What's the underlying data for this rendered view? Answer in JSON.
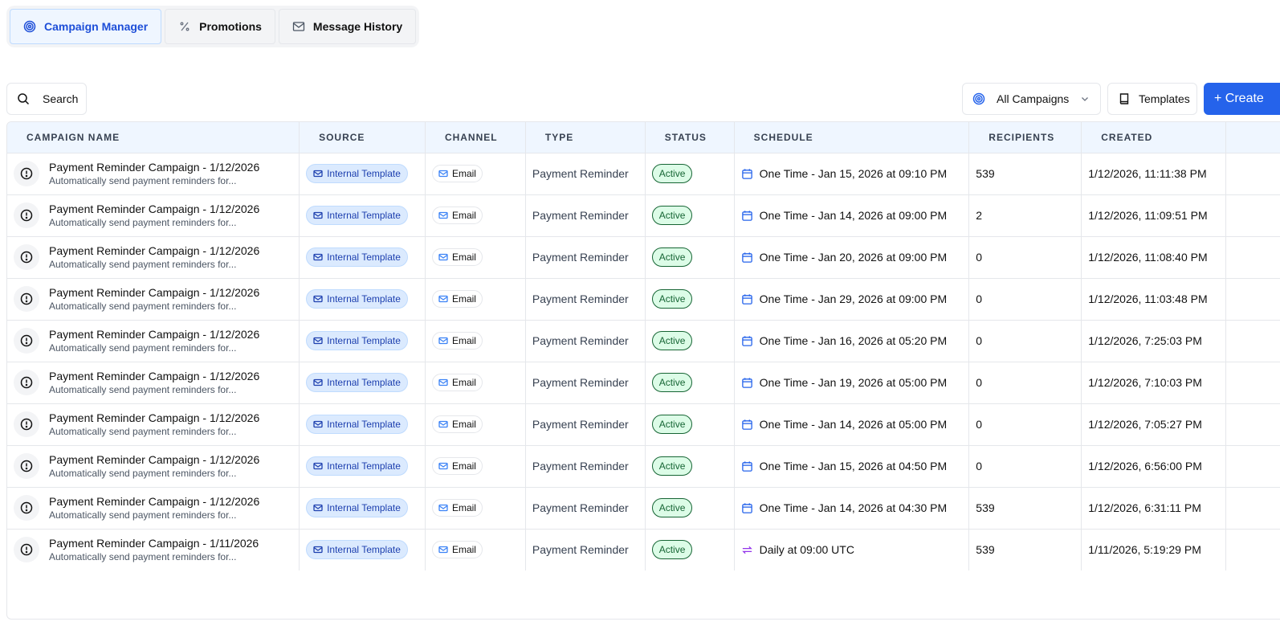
{
  "tabs": [
    {
      "label": "Campaign Manager",
      "icon": "target-icon"
    },
    {
      "label": "Promotions",
      "icon": "percent-icon"
    },
    {
      "label": "Message History",
      "icon": "mail-icon"
    }
  ],
  "toolbar": {
    "search_label": "Search",
    "filter_label": "All Campaigns",
    "templates_label": "Templates",
    "create_label": "+ Create"
  },
  "columns": [
    "CAMPAIGN NAME",
    "SOURCE",
    "CHANNEL",
    "TYPE",
    "STATUS",
    "SCHEDULE",
    "RECIPIENTS",
    "CREATED"
  ],
  "colors": {
    "accent": "#2563eb",
    "active": "#166534",
    "recurring": "#9333ea"
  },
  "rows": [
    {
      "name": "Payment Reminder Campaign - 1/12/2026",
      "desc": "Automatically send payment reminders for...",
      "source": "Internal Template",
      "channel": "Email",
      "type": "Payment Reminder",
      "status": "Active",
      "schedule": "One Time - Jan 15, 2026 at 09:10 PM",
      "schedule_icon": "calendar",
      "recipients": "539",
      "created": "1/12/2026, 11:11:38 PM"
    },
    {
      "name": "Payment Reminder Campaign - 1/12/2026",
      "desc": "Automatically send payment reminders for...",
      "source": "Internal Template",
      "channel": "Email",
      "type": "Payment Reminder",
      "status": "Active",
      "schedule": "One Time - Jan 14, 2026 at 09:00 PM",
      "schedule_icon": "calendar",
      "recipients": "2",
      "created": "1/12/2026, 11:09:51 PM"
    },
    {
      "name": "Payment Reminder Campaign - 1/12/2026",
      "desc": "Automatically send payment reminders for...",
      "source": "Internal Template",
      "channel": "Email",
      "type": "Payment Reminder",
      "status": "Active",
      "schedule": "One Time - Jan 20, 2026 at 09:00 PM",
      "schedule_icon": "calendar",
      "recipients": "0",
      "created": "1/12/2026, 11:08:40 PM"
    },
    {
      "name": "Payment Reminder Campaign - 1/12/2026",
      "desc": "Automatically send payment reminders for...",
      "source": "Internal Template",
      "channel": "Email",
      "type": "Payment Reminder",
      "status": "Active",
      "schedule": "One Time - Jan 29, 2026 at 09:00 PM",
      "schedule_icon": "calendar",
      "recipients": "0",
      "created": "1/12/2026, 11:03:48 PM"
    },
    {
      "name": "Payment Reminder Campaign - 1/12/2026",
      "desc": "Automatically send payment reminders for...",
      "source": "Internal Template",
      "channel": "Email",
      "type": "Payment Reminder",
      "status": "Active",
      "schedule": "One Time - Jan 16, 2026 at 05:20 PM",
      "schedule_icon": "calendar",
      "recipients": "0",
      "created": "1/12/2026, 7:25:03 PM"
    },
    {
      "name": "Payment Reminder Campaign - 1/12/2026",
      "desc": "Automatically send payment reminders for...",
      "source": "Internal Template",
      "channel": "Email",
      "type": "Payment Reminder",
      "status": "Active",
      "schedule": "One Time - Jan 19, 2026 at 05:00 PM",
      "schedule_icon": "calendar",
      "recipients": "0",
      "created": "1/12/2026, 7:10:03 PM"
    },
    {
      "name": "Payment Reminder Campaign - 1/12/2026",
      "desc": "Automatically send payment reminders for...",
      "source": "Internal Template",
      "channel": "Email",
      "type": "Payment Reminder",
      "status": "Active",
      "schedule": "One Time - Jan 14, 2026 at 05:00 PM",
      "schedule_icon": "calendar",
      "recipients": "0",
      "created": "1/12/2026, 7:05:27 PM"
    },
    {
      "name": "Payment Reminder Campaign - 1/12/2026",
      "desc": "Automatically send payment reminders for...",
      "source": "Internal Template",
      "channel": "Email",
      "type": "Payment Reminder",
      "status": "Active",
      "schedule": "One Time - Jan 15, 2026 at 04:50 PM",
      "schedule_icon": "calendar",
      "recipients": "0",
      "created": "1/12/2026, 6:56:00 PM"
    },
    {
      "name": "Payment Reminder Campaign - 1/12/2026",
      "desc": "Automatically send payment reminders for...",
      "source": "Internal Template",
      "channel": "Email",
      "type": "Payment Reminder",
      "status": "Active",
      "schedule": "One Time - Jan 14, 2026 at 04:30 PM",
      "schedule_icon": "calendar",
      "recipients": "539",
      "created": "1/12/2026, 6:31:11 PM"
    },
    {
      "name": "Payment Reminder Campaign - 1/11/2026",
      "desc": "Automatically send payment reminders for...",
      "source": "Internal Template",
      "channel": "Email",
      "type": "Payment Reminder",
      "status": "Active",
      "schedule": "Daily at 09:00 UTC",
      "schedule_icon": "repeat",
      "recipients": "539",
      "created": "1/11/2026, 5:19:29 PM"
    }
  ]
}
